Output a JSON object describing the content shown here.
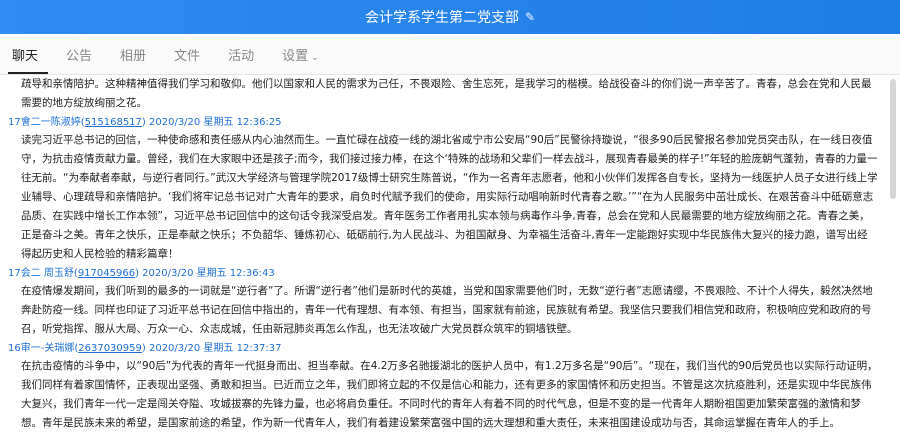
{
  "window": {
    "title": "会计学系学生第二党支部",
    "edit_icon": "pencil-icon"
  },
  "tabs": [
    {
      "label": "聊天",
      "active": true
    },
    {
      "label": "公告",
      "active": false
    },
    {
      "label": "相册",
      "active": false
    },
    {
      "label": "文件",
      "active": false
    },
    {
      "label": "活动",
      "active": false
    },
    {
      "label": "设置",
      "active": false,
      "dropdown_icon": "chevron-down-icon"
    }
  ],
  "messages": [
    {
      "text": "疏导和亲情陪护。这种精神值得我们学习和敬仰。他们以国家和人民的需求为己任，不畏艰险、舍生忘死，是我学习的楷模。给战役奋斗的你们说一声辛苦了。青春，总会在党和人民最需要的地方绽放绚丽之花。"
    },
    {
      "sender": "17會二一陈淑婷",
      "qq": "515168517",
      "datetime": "2020/3/20 星期五 12:36:25",
      "text": "读完习近平总书记的回信，一种使命感和责任感从内心油然而生。一直忙碌在战疫一线的湖北省咸宁市公安局“90后”民警徐持璇说，“很多90后民警报名参加党员突击队，在一线日夜值守，为抗击疫情贡献力量。曾经，我们在大家眼中还是孩子;而今，我们接过接力棒，在这个‘特殊的战场和父辈们一样去战斗，展现青春最美的样子!”年轻的脸庞朝气蓬勃，青春的力量一往无前。“为奉献者奉献，与逆行者同行。”武汉大学经济与管理学院2017级博士研究生陈普说，“作为一名青年志愿者，他和小伙伴们发挥各自专长，坚持为一线医护人员子女进行线上学业辅导、心理疏导和亲情陪护。‘我们将牢记总书记对广大青年的要求，肩负时代赋予我们的使命，用实际行动唱响新时代青春之歌。’”“在为人民服务中茁壮成长、在艰苦奋斗中砥砺意志品质、在实践中增长工作本领”，习近平总书记回信中的这句话令我深受启发。青年医务工作者用扎实本领与病毒作斗争,青春，总会在党和人民最需要的地方绽放绚丽之花。青春之美，正是奋斗之美。青年之快乐，正是奉献之快乐；不负韶华、锤炼初心、砥砺前行,为人民战斗、为祖国献身、为幸福生活奋斗,青年一定能跑好实现中华民族伟大复兴的接力跑，谱写出经得起历史和人民检验的精彩篇章！"
    },
    {
      "sender": "17会二 周玉舒",
      "qq": "917045966",
      "datetime": "2020/3/20 星期五 12:36:43",
      "text": "在疫情爆发期间，我们听到的最多的一词就是“逆行者”了。所谓“逆行者”他们是新时代的英雄，当党和国家需要他们时，无数“逆行者”志愿请缨，不畏艰险、不计个人得失，毅然决然地奔赴防疫一线。同样也印证了习近平总书记在回信中指出的，青年一代有理想、有本领、有担当，国家就有前途，民族就有希望。我坚信只要我们相信党和政府，积极响应党和政府的号召，听党指挥、服从大局、万众一心、众志成城，任由新冠肺炎再怎么作乱，也无法攻破广大党员群众筑牢的铜墙铁壁。"
    },
    {
      "sender": "16审一-关瑞娜",
      "qq": "2637030959",
      "datetime": "2020/3/20 星期五 12:37:37",
      "text": "在抗击疫情的斗争中，以“90后”为代表的青年一代挺身而出、担当奉献。在4.2万多名驰援湖北的医护人员中，有1.2万多名是“90后”。“现在，我们当代的90后党员也以实际行动证明，我们同样有着家国情怀，正表现出坚强、勇敢和担当。已近而立之年，我们即将立起的不仅是信心和能力，还有更多的家国情怀和历史担当。不管是这次抗疫胜利，还是实现中华民族伟大复兴，我们青年一代一定是闯关夺隘、攻城拔寨的先锋力量，也必将肩负重任。不同时代的青年人有着不同的时代气息，但是不变的是一代青年人期盼祖国更加繁荣富强的激情和梦想。青年是民族未来的希望，是国家前途的希望，作为新一代青年人，我们有着建设繁荣富强中国的远大理想和重大责任，未来祖国建设成功与否，其命运掌握在青年人的手上。"
    }
  ]
}
